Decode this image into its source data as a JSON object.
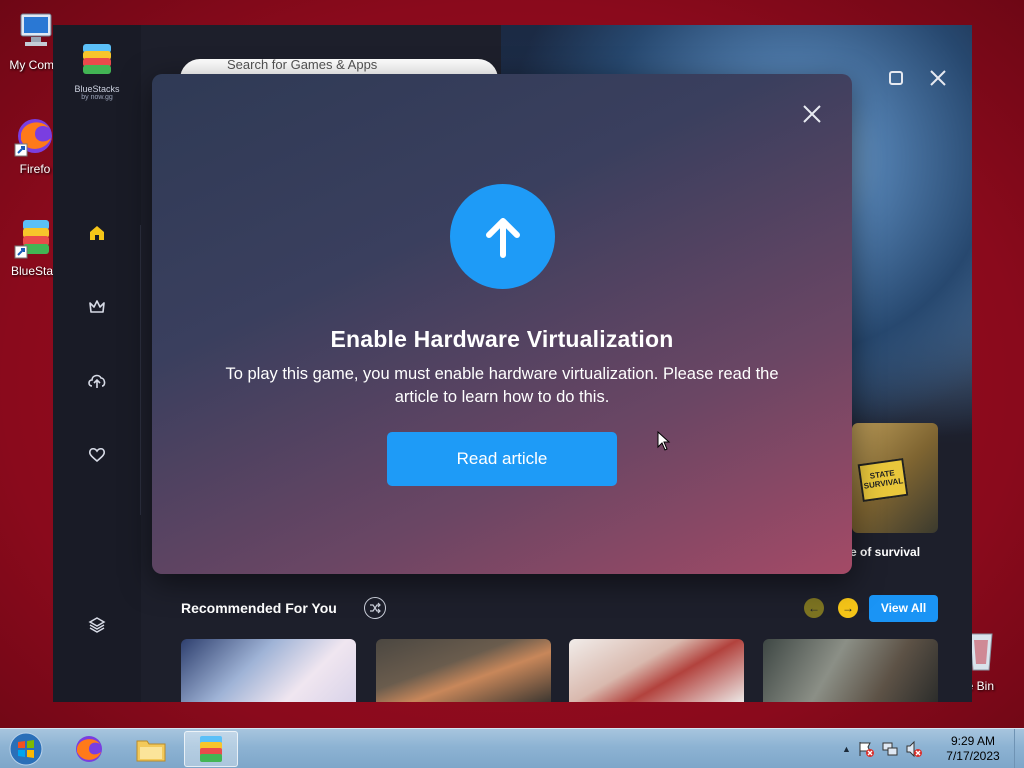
{
  "desktop": {
    "icons": [
      {
        "label": "My Comp",
        "icon": "computer-icon"
      },
      {
        "label": "Firefo",
        "icon": "firefox-icon"
      },
      {
        "label": "BlueStac",
        "icon": "bluestacks-icon"
      }
    ],
    "recycle_bin_label": "cle Bin"
  },
  "bluestacks": {
    "brand": "BlueStacks",
    "by_label": "by now.gg",
    "search_placeholder": "Search for Games & Apps",
    "sidebar": [
      {
        "name": "home",
        "icon": "home-icon"
      },
      {
        "name": "top-charts",
        "icon": "crown-icon"
      },
      {
        "name": "cloud",
        "icon": "cloud-upload-icon"
      },
      {
        "name": "favorites",
        "icon": "heart-icon"
      },
      {
        "name": "layers",
        "icon": "layers-icon"
      }
    ],
    "featured_caption": "e of survival",
    "featured_badge": "STATE SURVIVAL",
    "recommended_title": "Recommended For You",
    "view_all_label": "View All",
    "accent": "#1a94f5"
  },
  "modal": {
    "title": "Enable Hardware Virtualization",
    "body": "To play this game, you must enable hardware virtualization. Please read the article to learn how to do this.",
    "cta_label": "Read article",
    "icon": "arrow-up-icon"
  },
  "taskbar": {
    "time": "9:29 AM",
    "date": "7/17/2023"
  }
}
